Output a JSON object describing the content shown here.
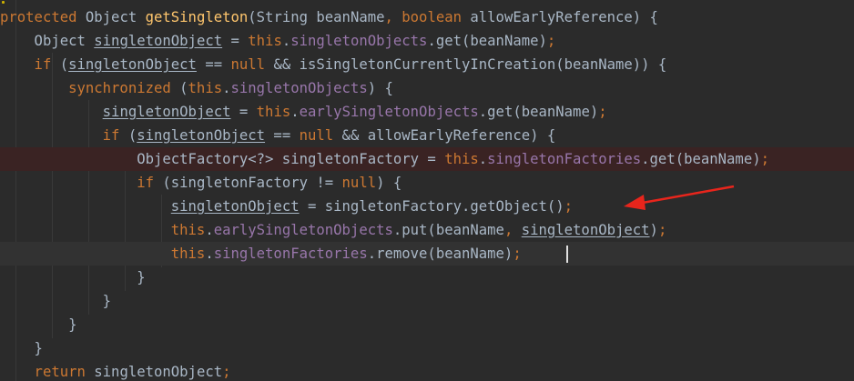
{
  "editor": {
    "lines": [
      {
        "text": "protected Object getSingleton(String beanName, boolean allowEarlyReference) {"
      },
      {
        "text": "    Object singletonObject = this.singletonObjects.get(beanName);"
      },
      {
        "text": "    if (singletonObject == null && isSingletonCurrentlyInCreation(beanName)) {"
      },
      {
        "text": "        synchronized (this.singletonObjects) {"
      },
      {
        "text": "            singletonObject = this.earlySingletonObjects.get(beanName);"
      },
      {
        "text": "            if (singletonObject == null && allowEarlyReference) {"
      },
      {
        "text": "                ObjectFactory<?> singletonFactory = this.singletonFactories.get(beanName);"
      },
      {
        "text": "                if (singletonFactory != null) {"
      },
      {
        "text": "                    singletonObject = singletonFactory.getObject();"
      },
      {
        "text": "                    this.earlySingletonObjects.put(beanName, singletonObject);"
      },
      {
        "text": "                    this.singletonFactories.remove(beanName);"
      },
      {
        "text": "                }"
      },
      {
        "text": "            }"
      },
      {
        "text": "        }"
      },
      {
        "text": "    }"
      },
      {
        "text": "    return singletonObject;"
      }
    ],
    "highlighted_line": 6,
    "current_line": 10,
    "annotation": {
      "type": "red-arrow",
      "target_line": 8
    }
  },
  "colors": {
    "background": "#2b2b2b",
    "keyword": "#cc7832",
    "field": "#9876aa",
    "method_decl": "#ffc66d",
    "text": "#a9b7c6",
    "highlight_line": "#3a2323",
    "current_line": "#323232",
    "annotation_arrow": "#e8251c"
  }
}
